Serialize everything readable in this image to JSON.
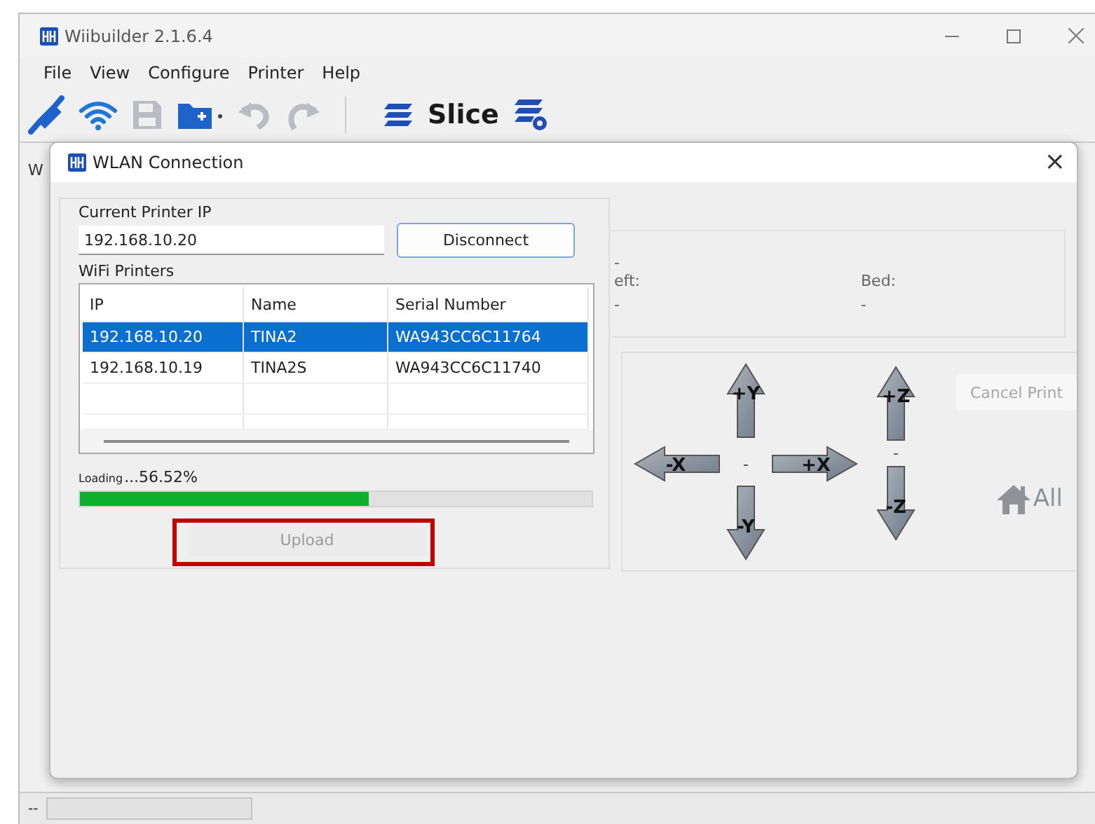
{
  "window": {
    "title": "Wiibuilder 2.1.6.4"
  },
  "menu": [
    "File",
    "View",
    "Configure",
    "Printer",
    "Help"
  ],
  "toolbar": {
    "slice_label": "Slice"
  },
  "background_tab": {
    "label": "W"
  },
  "dialog": {
    "title": "WLAN Connection",
    "close": "×",
    "current_ip_label": "Current Printer IP",
    "current_ip": "192.168.10.20",
    "disconnect_button": "Disconnect",
    "printers_label": "WiFi Printers",
    "table": {
      "columns": [
        "IP",
        "Name",
        "Serial Number"
      ],
      "rows": [
        {
          "cells": [
            "192.168.10.20",
            "TINA2",
            "WA943CC6C11764"
          ],
          "selected": true
        },
        {
          "cells": [
            "192.168.10.19",
            "TINA2S",
            "WA943CC6C11740"
          ],
          "selected": false
        }
      ]
    },
    "progress": {
      "label": "Loading",
      "value": "...56.52%",
      "level": 0.5652
    },
    "upload_button": {
      "label": "Upload",
      "disabled": true,
      "highlighted": true
    }
  },
  "temperature": {
    "top_value": "-",
    "left_label": "eft:",
    "left_value": "-",
    "bed_label": "Bed:",
    "bed_value": "-"
  },
  "jog": {
    "xy_center": "-",
    "z_center": "-",
    "buttons": [
      {
        "label": "+Y",
        "kind": "up"
      },
      {
        "label": "-X",
        "kind": "left"
      },
      {
        "label": "+X",
        "kind": "right"
      },
      {
        "label": "-Y",
        "kind": "down"
      },
      {
        "label": "+Z",
        "kind": "up"
      },
      {
        "label": "-Z",
        "kind": "down"
      }
    ],
    "cancel_button": "Cancel Print",
    "home_button": "All"
  },
  "status_bar": {
    "text": "--",
    "progress": {
      "level": 0
    }
  }
}
